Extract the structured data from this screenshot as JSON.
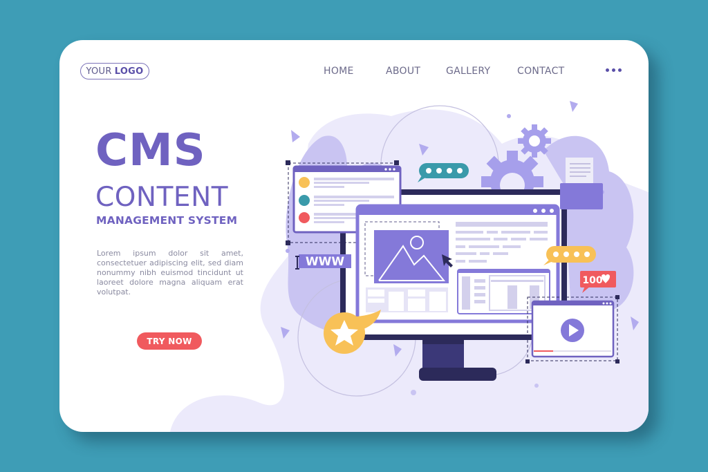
{
  "header": {
    "logo_light": "YOUR",
    "logo_bold": "LOGO",
    "nav": [
      {
        "label": "HOME"
      },
      {
        "label": "ABOUT"
      },
      {
        "label": "GALLERY"
      },
      {
        "label": "CONTACT"
      }
    ],
    "more_icon": "more-horizontal-icon"
  },
  "hero": {
    "title": "CMS",
    "subtitle": "CONTENT",
    "tagline": "MANAGEMENT SYSTEM",
    "body": "Lorem ipsum dolor sit amet, consectetuer adipiscing elit, sed diam nonummy nibh euismod tincidunt ut laoreet dolore magna aliquam erat volutpat.",
    "cta_label": "TRY NOW"
  },
  "illustration": {
    "url_badge": "WWW",
    "likes_badge": "100",
    "icons": [
      "gear-icon",
      "chat-bubble-icon",
      "folder-icon",
      "image-icon",
      "cursor-icon",
      "star-icon",
      "play-icon",
      "heart-icon"
    ]
  },
  "colors": {
    "background": "#3e9db6",
    "accent": "#6f62c0",
    "cta": "#f05a5e",
    "teal": "#3a9aaa",
    "yellow": "#f8c157",
    "dark": "#2c2a5a"
  }
}
